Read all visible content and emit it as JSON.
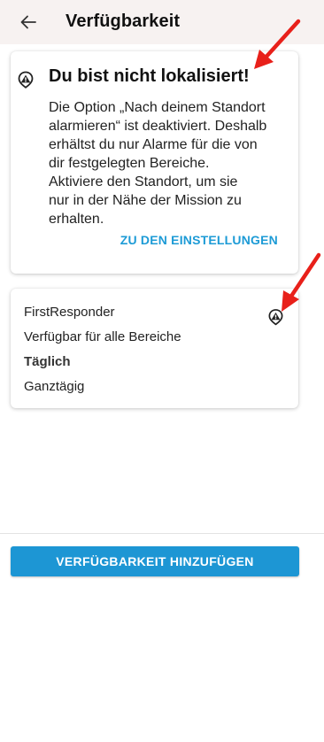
{
  "header": {
    "title": "Verfügbarkeit",
    "back_icon": "arrow-left-icon"
  },
  "warning_card": {
    "icon": "location-off-warning-icon",
    "title": "Du bist nicht lokalisiert!",
    "body_lines": [
      "Die Option „Nach deinem Standort",
      "alarmieren“ ist deaktiviert. Deshalb",
      "erhältst du nur Alarme für die von",
      "dir festgelegten Bereiche.",
      "Aktiviere den Standort, um sie",
      "nur in der Nähe der Mission zu",
      "erhalten."
    ],
    "link_label": "ZU DEN EINSTELLUNGEN",
    "link_color": "#1d9bd6"
  },
  "availability_card": {
    "name": "FirstResponder",
    "scope": "Verfügbar für alle Bereiche",
    "frequency": "Täglich",
    "time": "Ganztägig",
    "status_icon": "location-warning-icon"
  },
  "footer": {
    "add_button_label": "VERFÜGBARKEIT HINZUFÜGEN",
    "button_color": "#1d96d4"
  },
  "annotations": {
    "arrow_color": "#e8201a"
  }
}
